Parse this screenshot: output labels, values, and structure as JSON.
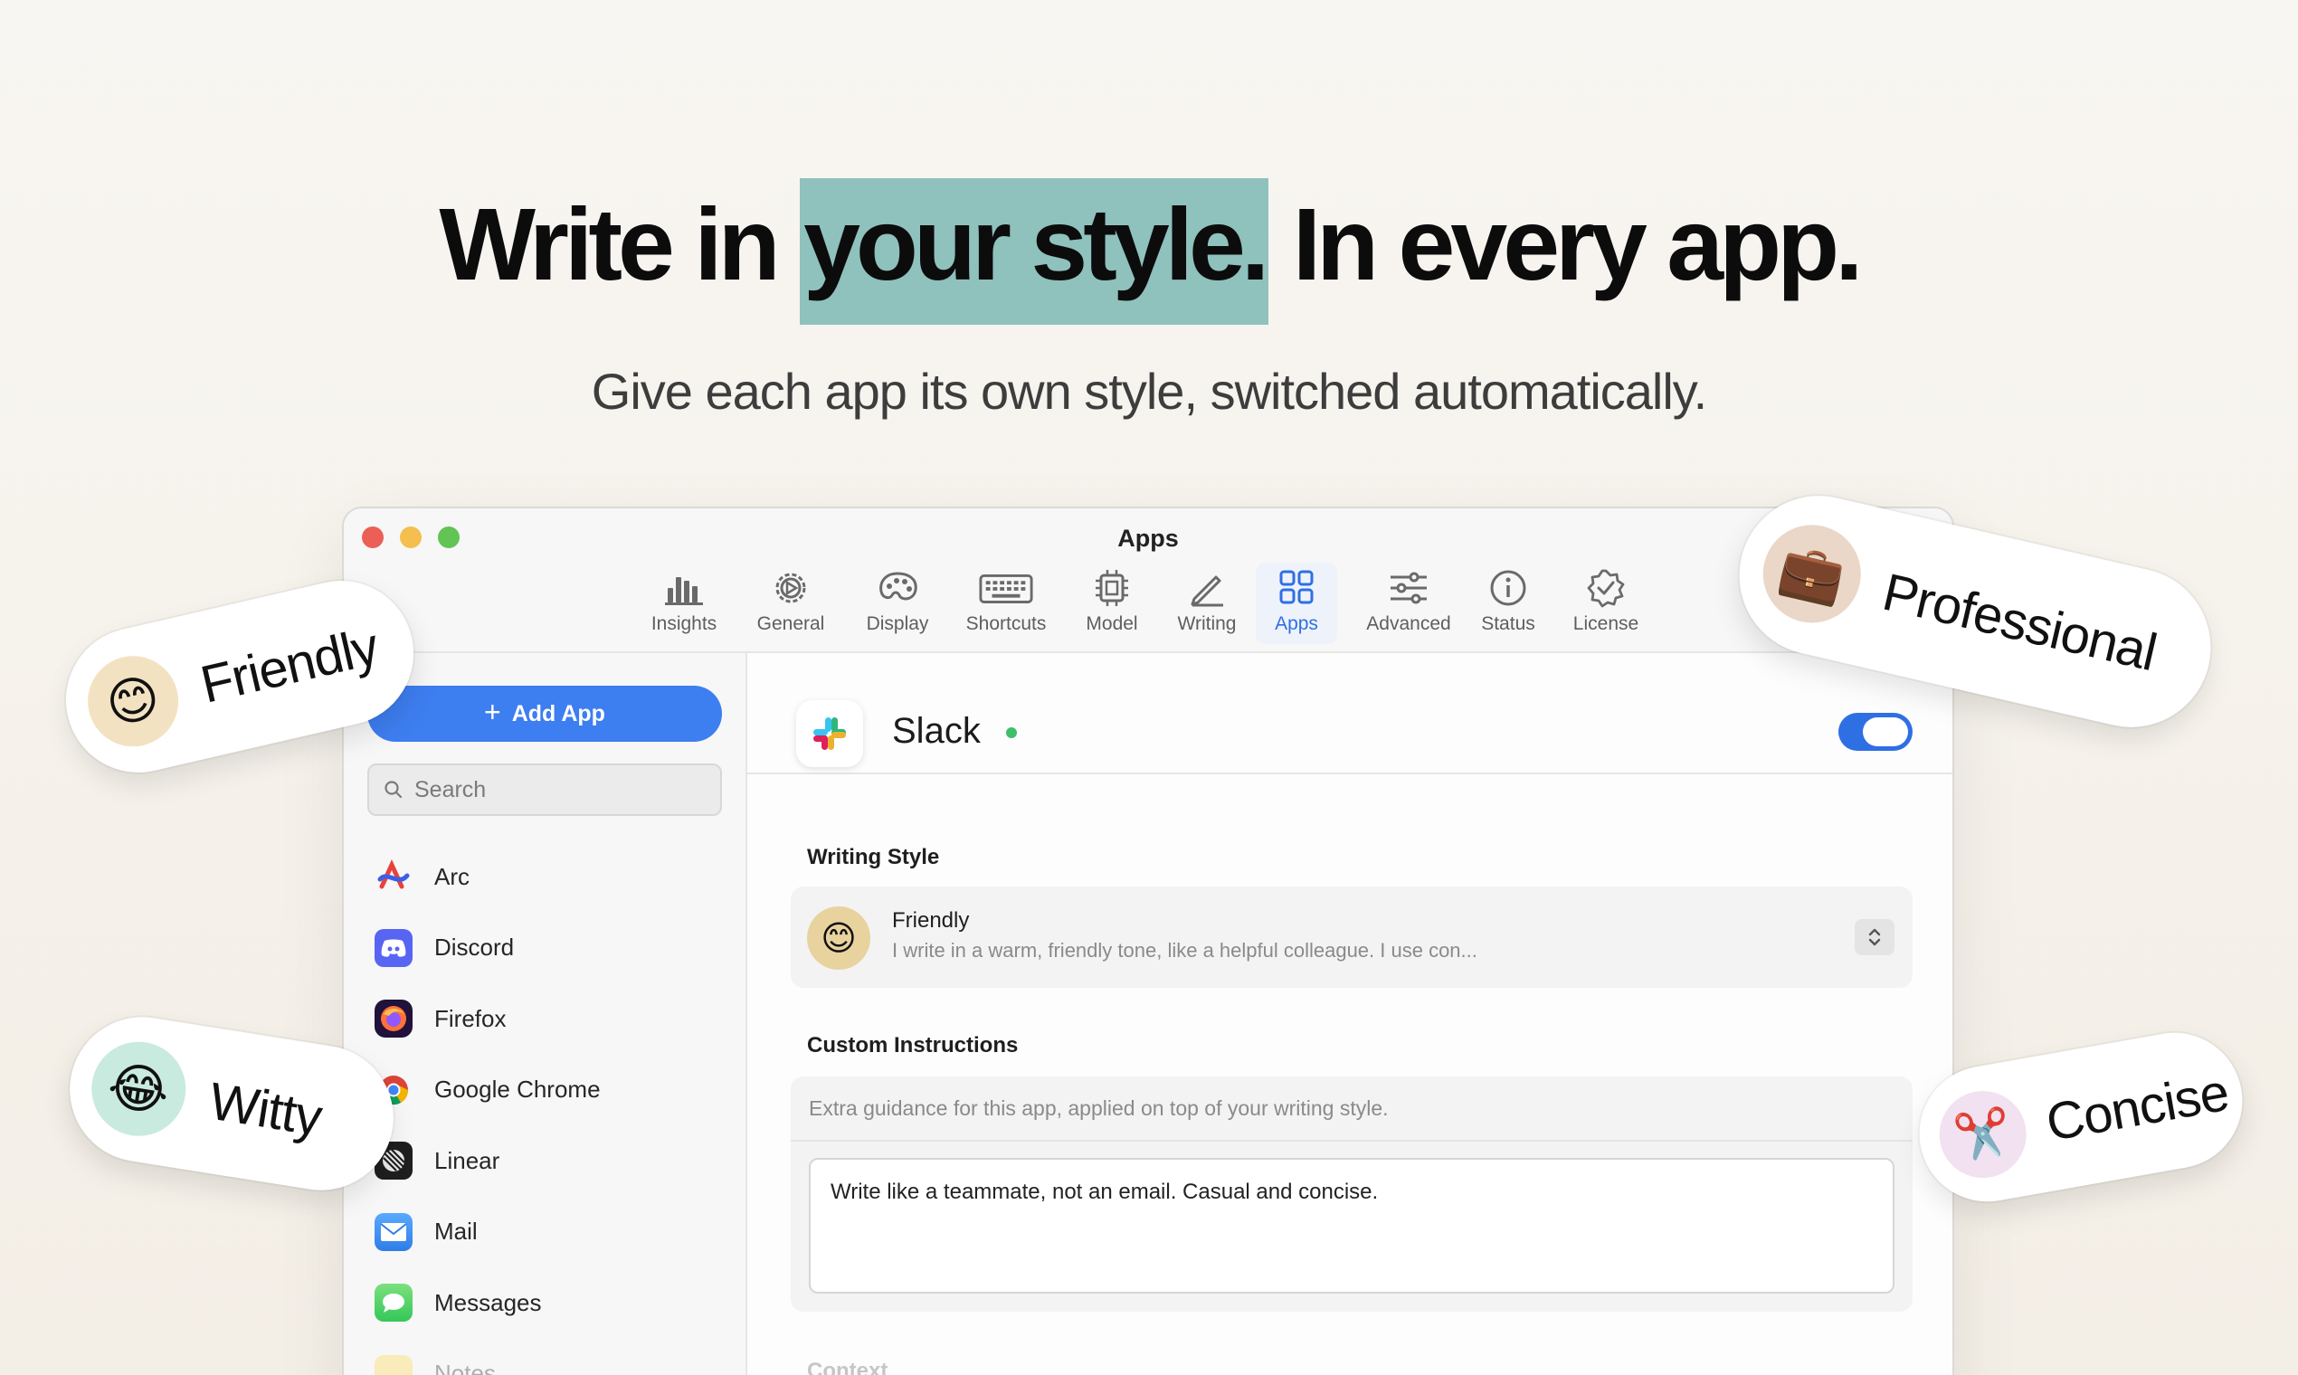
{
  "hero": {
    "title_before": "Write in ",
    "title_highlight": "your style.",
    "title_after": " In every app.",
    "subtitle": "Give each app its own style, switched automatically."
  },
  "window": {
    "title": "Apps",
    "toolbar": [
      {
        "label": "Insights",
        "icon": "bar-chart-icon"
      },
      {
        "label": "General",
        "icon": "gear-icon"
      },
      {
        "label": "Display",
        "icon": "palette-icon"
      },
      {
        "label": "Shortcuts",
        "icon": "keyboard-icon"
      },
      {
        "label": "Model",
        "icon": "chip-icon"
      },
      {
        "label": "Writing",
        "icon": "pencil-icon"
      },
      {
        "label": "Apps",
        "icon": "grid-icon",
        "active": true
      },
      {
        "label": "Advanced",
        "icon": "sliders-icon"
      },
      {
        "label": "Status",
        "icon": "info-icon"
      },
      {
        "label": "License",
        "icon": "verified-badge-icon"
      }
    ],
    "accent_color": "#2f6fe4"
  },
  "sidebar": {
    "add_button": "Add App",
    "search_placeholder": "Search",
    "apps": [
      {
        "name": "Arc",
        "icon": "arc-icon"
      },
      {
        "name": "Discord",
        "icon": "discord-icon"
      },
      {
        "name": "Firefox",
        "icon": "firefox-icon"
      },
      {
        "name": "Google Chrome",
        "icon": "chrome-icon"
      },
      {
        "name": "Linear",
        "icon": "linear-icon"
      },
      {
        "name": "Mail",
        "icon": "mail-icon"
      },
      {
        "name": "Messages",
        "icon": "messages-icon"
      },
      {
        "name": "Notes",
        "icon": "notes-icon"
      }
    ]
  },
  "detail": {
    "app_name": "Slack",
    "status": "online",
    "enabled": true,
    "writing_style_label": "Writing Style",
    "style": {
      "name": "Friendly",
      "emoji": "😊",
      "description": "I write in a warm, friendly tone, like a helpful colleague. I use con..."
    },
    "custom_instructions_label": "Custom Instructions",
    "custom_instructions_hint": "Extra guidance for this app, applied on top of your writing style.",
    "custom_instructions_value": "Write like a teammate, not an email. Casual and concise.",
    "context_label": "Context"
  },
  "pills": {
    "friendly": {
      "label": "Friendly",
      "emoji": "😊"
    },
    "witty": {
      "label": "Witty",
      "emoji": "😂"
    },
    "professional": {
      "label": "Professional",
      "emoji": "💼"
    },
    "concise": {
      "label": "Concise",
      "emoji": "✂️"
    }
  }
}
